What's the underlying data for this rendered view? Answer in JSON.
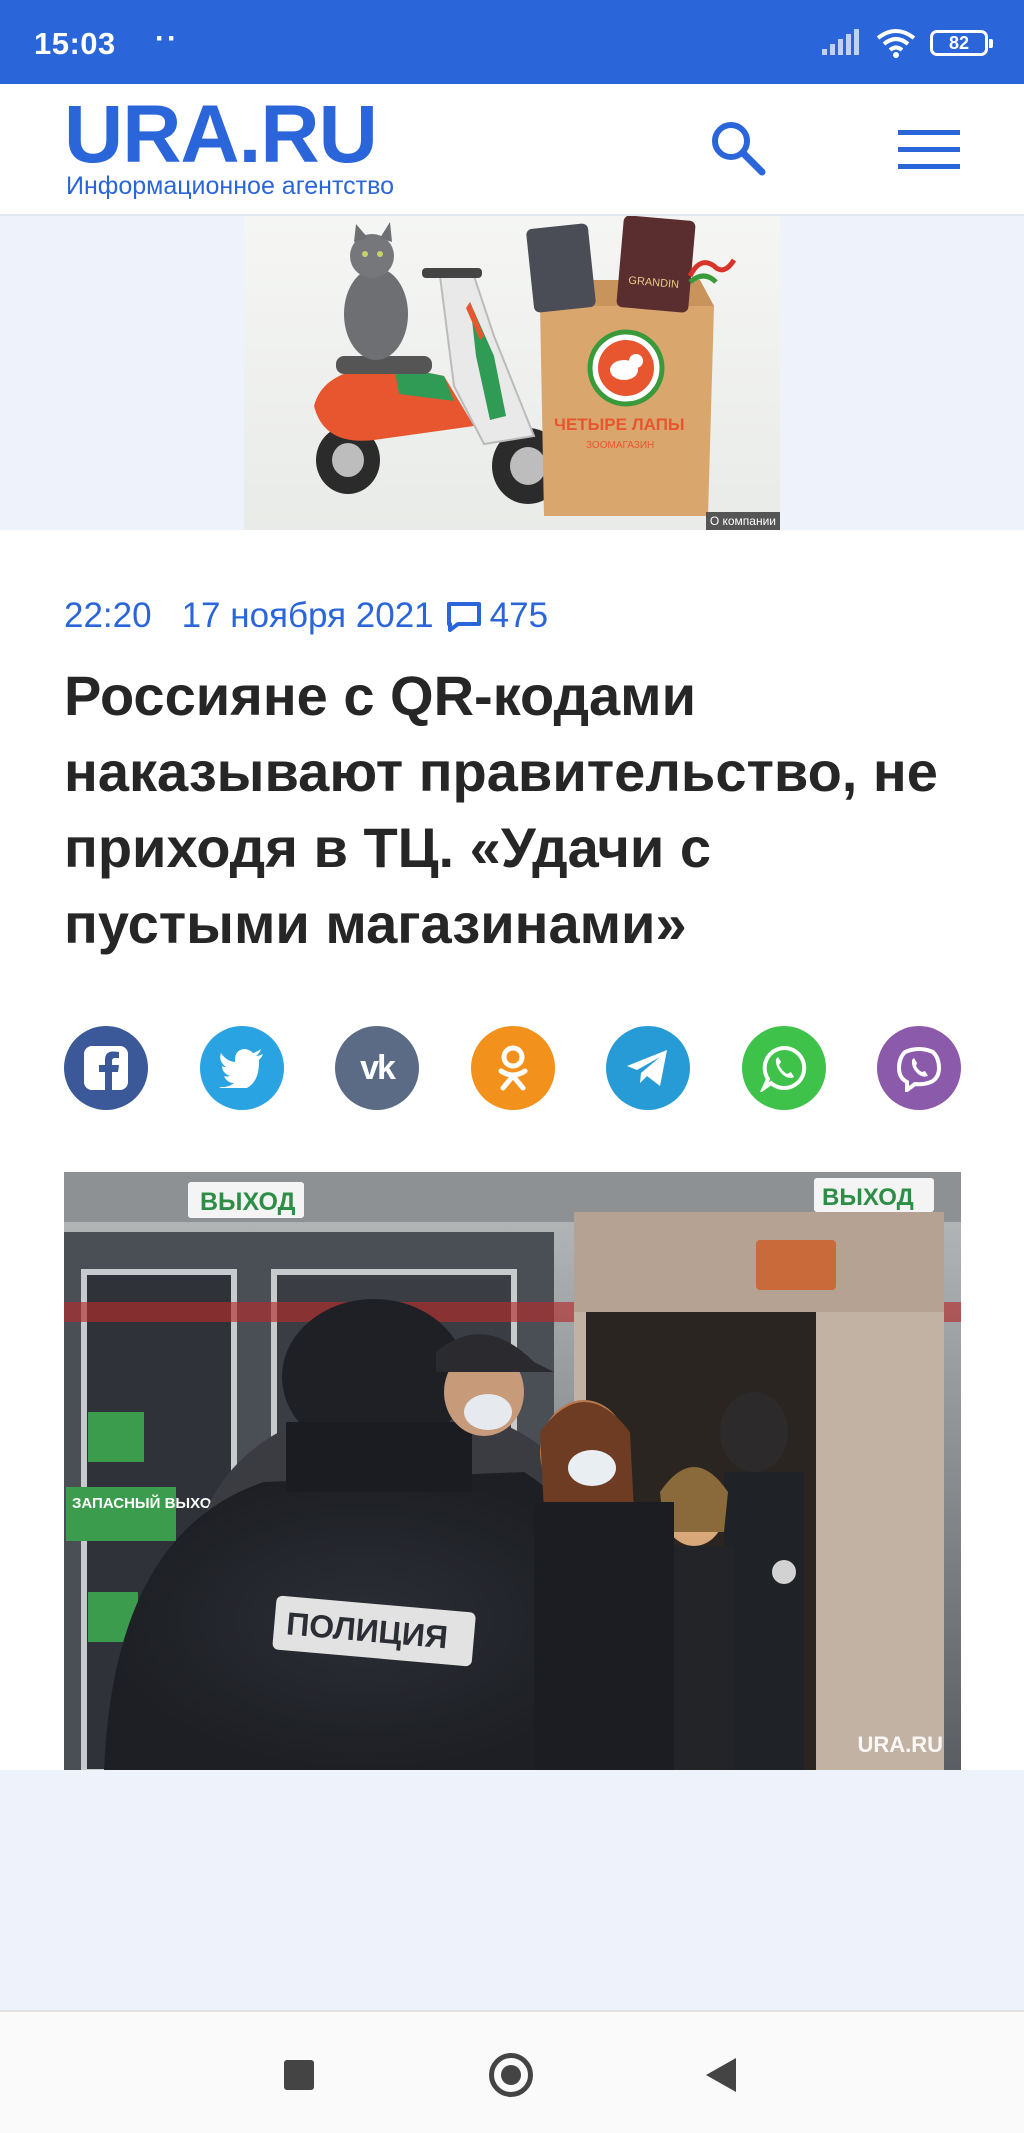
{
  "status_bar": {
    "time": "15:03",
    "dots": "··",
    "battery": "82"
  },
  "header": {
    "logo": "URA.RU",
    "tagline": "Информационное агентство",
    "search_icon": "search-icon",
    "menu_icon": "hamburger-menu-icon"
  },
  "ad": {
    "brand": "ЧЕТЫРЕ ЛАПЫ",
    "brand_sub": "ЗООМАГАЗИН",
    "credit": "О компании"
  },
  "article": {
    "time": "22:20",
    "date": "17 ноября 2021",
    "comments_count": "475",
    "headline": "Россияне с QR-кодами наказывают правительство, не приходя в ТЦ. «Удачи с пустыми магазинами»",
    "share": [
      {
        "name": "facebook",
        "icon": "facebook-icon",
        "color": "#3b5998"
      },
      {
        "name": "twitter",
        "icon": "twitter-icon",
        "color": "#2aa3e3"
      },
      {
        "name": "vk",
        "icon": "vk-icon",
        "color": "#5b6b86"
      },
      {
        "name": "odnoklassniki",
        "icon": "odnoklassniki-icon",
        "color": "#f2921c"
      },
      {
        "name": "telegram",
        "icon": "telegram-icon",
        "color": "#279bd6"
      },
      {
        "name": "whatsapp",
        "icon": "whatsapp-icon",
        "color": "#3ec24a"
      },
      {
        "name": "viber",
        "icon": "viber-icon",
        "color": "#8b5aab"
      }
    ],
    "photo": {
      "exit_sign_left": "ВЫХОД",
      "exit_sign_right": "ВЫХОД",
      "emergency_exit": "ЗАПАСНЫЙ ВЫХОД",
      "police_label": "ПОЛИЦИЯ",
      "watermark": "URA.RU"
    }
  },
  "nav": {
    "recent": "recent-apps-icon",
    "home": "home-icon",
    "back": "back-icon"
  }
}
